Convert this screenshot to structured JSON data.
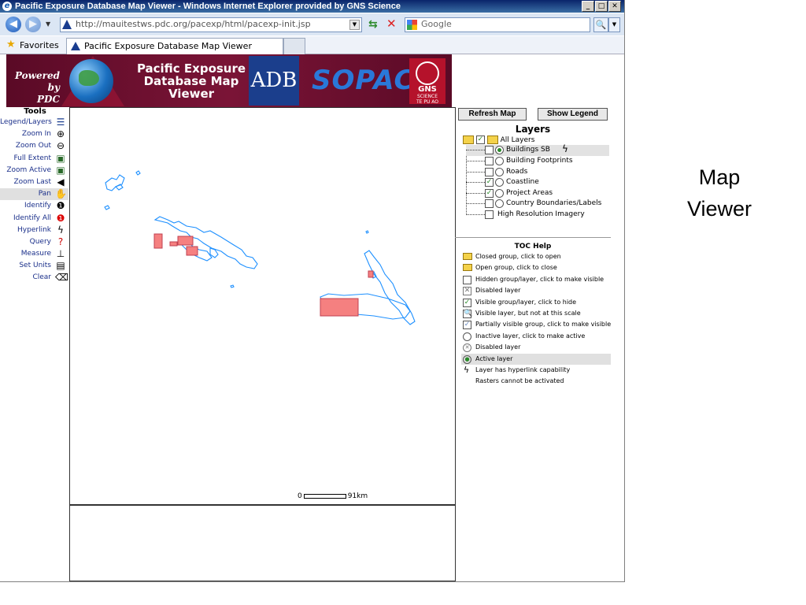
{
  "window": {
    "title": "Pacific Exposure Database Map Viewer - Windows Internet Explorer provided by GNS Science"
  },
  "browser": {
    "url": "http://mauitestws.pdc.org/pacexp/html/pacexp-init.jsp",
    "search_placeholder": "Google",
    "favorites_label": "Favorites",
    "tab_title": "Pacific Exposure Database Map Viewer"
  },
  "banner": {
    "powered_by_line1": "Powered by",
    "powered_by_line2": "PDC",
    "title_line1": "Pacific Exposure",
    "title_line2": "Database Map",
    "title_line3": "Viewer",
    "adb": "ADB",
    "sopac": "SOPAC",
    "gns": "GNS",
    "gns_sub1": "SCIENCE",
    "gns_sub2": "TE PU AO"
  },
  "tools": {
    "title": "Tools",
    "items": [
      {
        "label": "Legend/Layers",
        "icon": "legend-icon"
      },
      {
        "label": "Zoom In",
        "icon": "zoom-in-icon"
      },
      {
        "label": "Zoom Out",
        "icon": "zoom-out-icon"
      },
      {
        "label": "Full Extent",
        "icon": "full-extent-icon"
      },
      {
        "label": "Zoom Active",
        "icon": "zoom-active-icon"
      },
      {
        "label": "Zoom Last",
        "icon": "zoom-last-icon"
      },
      {
        "label": "Pan",
        "icon": "hand-icon"
      },
      {
        "label": "Identify",
        "icon": "identify-icon"
      },
      {
        "label": "Identify All",
        "icon": "identify-all-icon"
      },
      {
        "label": "Hyperlink",
        "icon": "lightning-icon"
      },
      {
        "label": "Query",
        "icon": "query-icon"
      },
      {
        "label": "Measure",
        "icon": "measure-icon"
      },
      {
        "label": "Set Units",
        "icon": "units-icon"
      },
      {
        "label": "Clear",
        "icon": "eraser-icon"
      }
    ]
  },
  "map": {
    "scale_start": "0",
    "scale_end": "91km"
  },
  "panel": {
    "refresh_label": "Refresh Map",
    "legend_label": "Show Legend",
    "layers_title": "Layers",
    "all_layers": "All Layers",
    "layers": [
      {
        "label": "Buildings SB",
        "checked": false,
        "active": true
      },
      {
        "label": "Building Footprints",
        "checked": false,
        "active": false
      },
      {
        "label": "Roads",
        "checked": false,
        "active": false
      },
      {
        "label": "Coastline",
        "checked": true,
        "active": false
      },
      {
        "label": "Project Areas",
        "checked": true,
        "active": false
      },
      {
        "label": "Country Boundaries/Labels",
        "checked": false,
        "active": false
      },
      {
        "label": "High Resolution Imagery",
        "checked": false,
        "active": false
      }
    ],
    "toc_title": "TOC Help",
    "toc_items": [
      "Closed group, click to open",
      "Open group, click to close",
      "Hidden group/layer, click to make visible",
      "Disabled layer",
      "Visible group/layer, click to hide",
      "Visible layer, but not at this scale",
      "Partially visible group, click to make visible",
      "Inactive layer, click to make active",
      "Disabled layer",
      "Active layer",
      "Layer has hyperlink capability",
      "Rasters cannot be activated"
    ]
  },
  "caption": {
    "line1": "Map",
    "line2": "Viewer"
  },
  "colors": {
    "banner": "#6e1030",
    "coastline": "#1e90ff",
    "project_area_fill": "#f58080",
    "tool_text": "#1a2f8a"
  }
}
